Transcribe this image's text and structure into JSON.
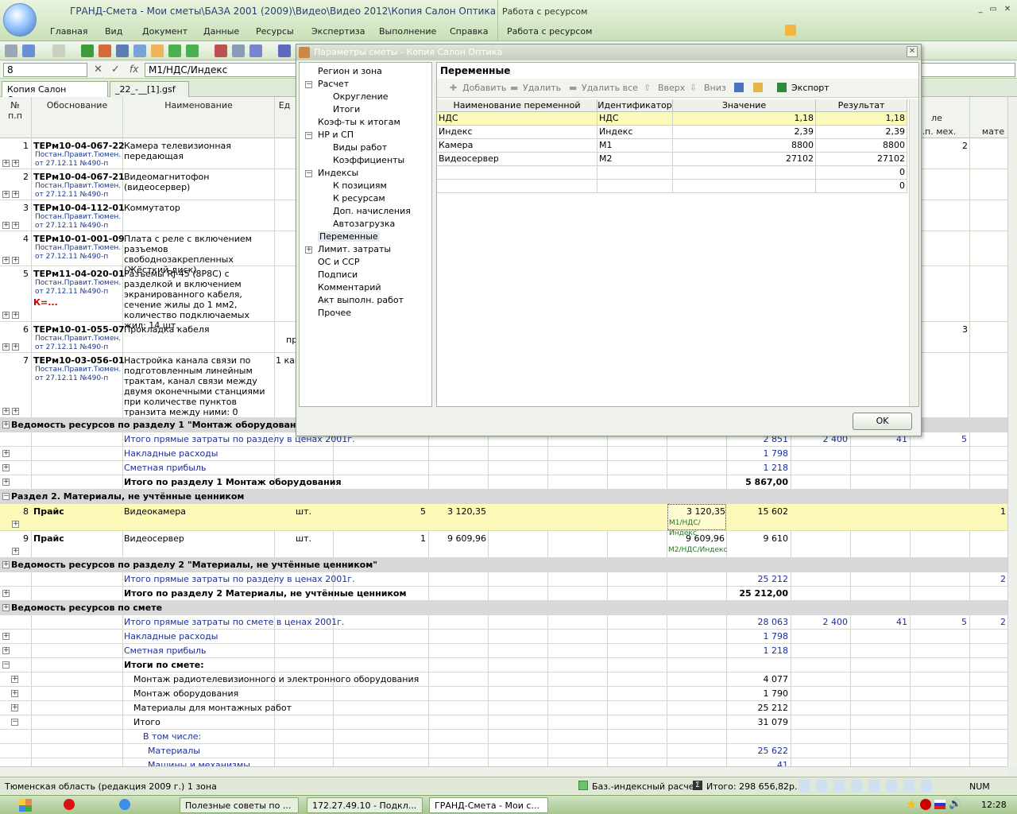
{
  "window": {
    "title": "ГРАНД-Смета - Мои сметы\\БАЗА 2001 (2009)\\Видео\\Видео 2012\\Копия Салон Оптика",
    "context_title": "Работа с ресурсом"
  },
  "menu": [
    "Главная",
    "Вид",
    "Документ",
    "Данные",
    "Ресурсы",
    "Экспертиза",
    "Выполнение",
    "Справка",
    "Работа с ресурсом"
  ],
  "formula_bar": {
    "cell": "8",
    "formula": "М1/НДС/Индекс"
  },
  "doc_tabs": [
    "Копия Салон Оптика",
    "_22_-__[1].gsf"
  ],
  "grid": {
    "headers": {
      "num": "№\nп.п",
      "basis": "Обоснование",
      "name": "Наименование",
      "unit": "Ед",
      "col_a": "з.п. мех.",
      "col_b": "мате",
      "col_c": "ле"
    },
    "rows": [
      {
        "n": "1",
        "code": "ТЕРм10-04-067-22",
        "note1": "Постан.Правит.Тюмен.",
        "note2": "от 27.12.11 №490-п",
        "name": "Камера телевизионная передающая",
        "extra": "2"
      },
      {
        "n": "2",
        "code": "ТЕРм10-04-067-21",
        "note1": "Постан.Правит.Тюмен.",
        "note2": "от 27.12.11 №490-п",
        "name": "Видеомагнитофон (видеосервер)"
      },
      {
        "n": "3",
        "code": "ТЕРм10-04-112-01",
        "note1": "Постан.Правит.Тюмен.",
        "note2": "от 27.12.11 №490-п",
        "name": "Коммутатор"
      },
      {
        "n": "4",
        "code": "ТЕРм10-01-001-09",
        "note1": "Постан.Правит.Тюмен.",
        "note2": "от 27.12.11 №490-п",
        "name": "Плата с реле с включением разъемов свободнозакрепленных (Жёсткий диск)"
      },
      {
        "n": "5",
        "code": "ТЕРм11-04-020-01",
        "note1": "Постан.Правит.Тюмен.",
        "note2": "от 27.12.11 №490-п",
        "name": "Разъемы RJ-45 (8P8C) с разделкой и включением экранированного кабеля, сечение жилы до 1 мм2, количество подключаемых жил: 14 шт.",
        "k": "К=..."
      },
      {
        "n": "6",
        "code": "ТЕРм10-01-055-07",
        "note1": "Постан.Правит.Тюмен.",
        "note2": "от 27.12.11 №490-п",
        "name": "Прокладка кабеля",
        "unit": "пр",
        "extra": "3"
      },
      {
        "n": "7",
        "code": "ТЕРм10-03-056-01",
        "note1": "Постан.Правит.Тюмен.",
        "note2": "от 27.12.11 №490-п",
        "name": "Настройка канала связи по подготовленным линейным трактам, канал связи между двумя оконечными станциями при количестве пунктов транзита между ними: 0",
        "unit": "1 кан"
      }
    ],
    "sec1_res": "Ведомость ресурсов по разделу 1 \"Монтаж оборудования\"",
    "sec1_direct": {
      "label": "Итого прямые затраты по разделу в ценах 2001г.",
      "v1": "2 851",
      "v2": "2 400",
      "v3": "41",
      "v4": "5"
    },
    "sec1_overhead": {
      "label": "Накладные расходы",
      "v1": "1 798"
    },
    "sec1_profit": {
      "label": "Сметная прибыль",
      "v1": "1 218"
    },
    "sec1_total": {
      "label": "Итого по разделу 1 Монтаж оборудования",
      "v1": "5 867,00"
    },
    "sec2_title": "Раздел 2. Материалы, не учтённые ценником",
    "row8": {
      "n": "8",
      "code": "Прайс",
      "name": "Видеокамера",
      "unit": "шт.",
      "qty": "5",
      "price": "3 120,35",
      "cur": "3 120,35",
      "formula": "М1/НДС/Индекс",
      "total": "15 602",
      "last": "1"
    },
    "row9": {
      "n": "9",
      "code": "Прайс",
      "name": "Видеосервер",
      "unit": "шт.",
      "qty": "1",
      "price": "9 609,96",
      "cur": "9 609,96",
      "formula": "М2/НДС/Индекс",
      "total": "9 610"
    },
    "sec2_res": "Ведомость ресурсов по разделу 2 \"Материалы, не учтённые ценником\"",
    "sec2_direct": {
      "label": "Итого прямые затраты по разделу в ценах 2001г.",
      "v1": "25 212",
      "last": "2"
    },
    "sec2_total": {
      "label": "Итого по разделу 2 Материалы, не учтённые ценником",
      "v1": "25 212,00"
    },
    "est_res": "Ведомость ресурсов по смете",
    "est_direct": {
      "label": "Итого прямые затраты по смете в ценах 2001г.",
      "v1": "28 063",
      "v2": "2 400",
      "v3": "41",
      "v4": "5",
      "last": "2"
    },
    "est_overhead": {
      "label": "Накладные расходы",
      "v1": "1 798"
    },
    "est_profit": {
      "label": "Сметная прибыль",
      "v1": "1 218"
    },
    "est_totals": {
      "label": "Итоги по смете:"
    },
    "est_lines": [
      {
        "label": "Монтаж радиотелевизионного и электронного оборудования",
        "v1": "4 077"
      },
      {
        "label": "Монтаж оборудования",
        "v1": "1 790"
      },
      {
        "label": "Материалы для монтажных работ",
        "v1": "25 212"
      },
      {
        "label": "Итого",
        "v1": "31 079"
      }
    ],
    "incl": "В том числе:",
    "incl_lines": [
      {
        "label": "Материалы",
        "v1": "25 622"
      },
      {
        "label": "Машины и механизмы",
        "v1": "41"
      }
    ]
  },
  "status": {
    "region": "Тюменская область (редакция 2009 г.)  1 зона",
    "calc": "Баз.-индексный расчет",
    "total": "Итого: 298 656,82р.",
    "num": "NUM"
  },
  "taskbar": {
    "t1": "Полезные советы по ...",
    "t2": "172.27.49.10 - Подкл...",
    "t3": "ГРАНД-Смета - Мои с...",
    "clock": "12:28"
  },
  "dialog": {
    "title": "Параметры сметы - Копия Салон Оптика",
    "tree": [
      {
        "l": "Регион и зона",
        "lvl": 0
      },
      {
        "l": "Расчет",
        "lvl": 0,
        "exp": "-"
      },
      {
        "l": "Округление",
        "lvl": 1
      },
      {
        "l": "Итоги",
        "lvl": 1
      },
      {
        "l": "Коэф-ты к итогам",
        "lvl": 0
      },
      {
        "l": "НР и СП",
        "lvl": 0,
        "exp": "-"
      },
      {
        "l": "Виды работ",
        "lvl": 1
      },
      {
        "l": "Коэффициенты",
        "lvl": 1
      },
      {
        "l": "Индексы",
        "lvl": 0,
        "exp": "-"
      },
      {
        "l": "К позициям",
        "lvl": 1
      },
      {
        "l": "К ресурсам",
        "lvl": 1
      },
      {
        "l": "Доп. начисления",
        "lvl": 1
      },
      {
        "l": "Автозагрузка",
        "lvl": 1
      },
      {
        "l": "Переменные",
        "lvl": 0,
        "sel": true
      },
      {
        "l": "Лимит. затраты",
        "lvl": 0,
        "exp": "+"
      },
      {
        "l": "ОС и ССР",
        "lvl": 0
      },
      {
        "l": "Подписи",
        "lvl": 0
      },
      {
        "l": "Комментарий",
        "lvl": 0
      },
      {
        "l": "Акт выполн. работ",
        "lvl": 0
      },
      {
        "l": "Прочее",
        "lvl": 0
      }
    ],
    "panel_title": "Переменные",
    "toolbar": {
      "add": "Добавить",
      "del": "Удалить",
      "del_all": "Удалить все",
      "up": "Вверх",
      "down": "Вниз",
      "export": "Экспорт"
    },
    "cols": [
      "Наименование переменной",
      "Идентификатор",
      "Значение",
      "Результат"
    ],
    "vars": [
      {
        "name": "НДС",
        "id": "НДС",
        "val": "1,18",
        "res": "1,18"
      },
      {
        "name": "Индекс",
        "id": "Индекс",
        "val": "2,39",
        "res": "2,39"
      },
      {
        "name": "Камера",
        "id": "М1",
        "val": "8800",
        "res": "8800"
      },
      {
        "name": "Видеосервер",
        "id": "М2",
        "val": "27102",
        "res": "27102"
      },
      {
        "name": "",
        "id": "",
        "val": "",
        "res": "0"
      },
      {
        "name": "",
        "id": "",
        "val": "",
        "res": "0"
      }
    ],
    "ok": "OK"
  }
}
